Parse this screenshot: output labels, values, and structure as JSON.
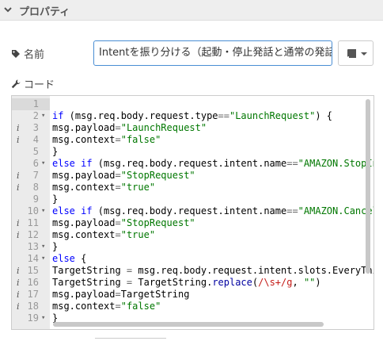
{
  "section": {
    "title": "プロパティ"
  },
  "name_field": {
    "label": "名前",
    "value": "Intentを振り分ける（起動・停止発話と通常の発話）"
  },
  "code_field": {
    "label": "コード"
  },
  "editor": {
    "active_line": 1,
    "lines": [
      {
        "n": "1",
        "info": "",
        "fold": "",
        "html": ""
      },
      {
        "n": "2",
        "info": "",
        "fold": "▾",
        "html": "<span class=\"kw\">if</span> (msg.req.body.request.type<span class=\"op\">==</span><span class=\"str\">\"LaunchRequest\"</span>) {"
      },
      {
        "n": "3",
        "info": "i",
        "fold": "",
        "html": "msg.payload<span class=\"op\">=</span><span class=\"str\">\"LaunchRequest\"</span>"
      },
      {
        "n": "4",
        "info": "i",
        "fold": "",
        "html": "msg.context<span class=\"op\">=</span><span class=\"str\">\"false\"</span>"
      },
      {
        "n": "5",
        "info": "",
        "fold": "",
        "html": "}"
      },
      {
        "n": "6",
        "info": "",
        "fold": "▾",
        "html": "<span class=\"kw\">else if</span> (msg.req.body.request.intent.name<span class=\"op\">==</span><span class=\"str\">\"AMAZON.StopIntent\"</span>) {"
      },
      {
        "n": "7",
        "info": "i",
        "fold": "",
        "html": "msg.payload<span class=\"op\">=</span><span class=\"str\">\"StopRequest\"</span>"
      },
      {
        "n": "8",
        "info": "i",
        "fold": "",
        "html": "msg.context<span class=\"op\">=</span><span class=\"str\">\"true\"</span>"
      },
      {
        "n": "9",
        "info": "",
        "fold": "",
        "html": "}"
      },
      {
        "n": "10",
        "info": "",
        "fold": "▾",
        "html": "<span class=\"kw\">else if</span> (msg.req.body.request.intent.name<span class=\"op\">==</span><span class=\"str\">\"AMAZON.CancelIntent\"</span>) {"
      },
      {
        "n": "11",
        "info": "i",
        "fold": "",
        "html": "msg.payload<span class=\"op\">=</span><span class=\"str\">\"StopRequest\"</span>"
      },
      {
        "n": "12",
        "info": "i",
        "fold": "",
        "html": "msg.context<span class=\"op\">=</span><span class=\"str\">\"true\"</span>"
      },
      {
        "n": "13",
        "info": "",
        "fold": "▾",
        "html": "}"
      },
      {
        "n": "14",
        "info": "",
        "fold": "▾",
        "html": "<span class=\"kw\">else</span> {"
      },
      {
        "n": "15",
        "info": "i",
        "fold": "",
        "html": "TargetString <span class=\"op\">=</span> msg.req.body.request.intent.slots.EveryThingSlot.value;"
      },
      {
        "n": "16",
        "info": "i",
        "fold": "",
        "html": "TargetString <span class=\"op\">=</span> TargetString.<span class=\"fn\">replace</span>(<span class=\"re\">/\\s+/g</span>, <span class=\"str\">\"\"</span>)"
      },
      {
        "n": "17",
        "info": "i",
        "fold": "",
        "html": "msg.payload<span class=\"op\">=</span>TargetString"
      },
      {
        "n": "18",
        "info": "i",
        "fold": "",
        "html": "msg.context<span class=\"op\">=</span><span class=\"str\">\"false\"</span>"
      },
      {
        "n": "19",
        "info": "",
        "fold": "▾",
        "html": "}"
      }
    ]
  },
  "colors": {
    "accent": "#4a8ed4",
    "keyword": "#0000ff",
    "string": "#007700"
  }
}
